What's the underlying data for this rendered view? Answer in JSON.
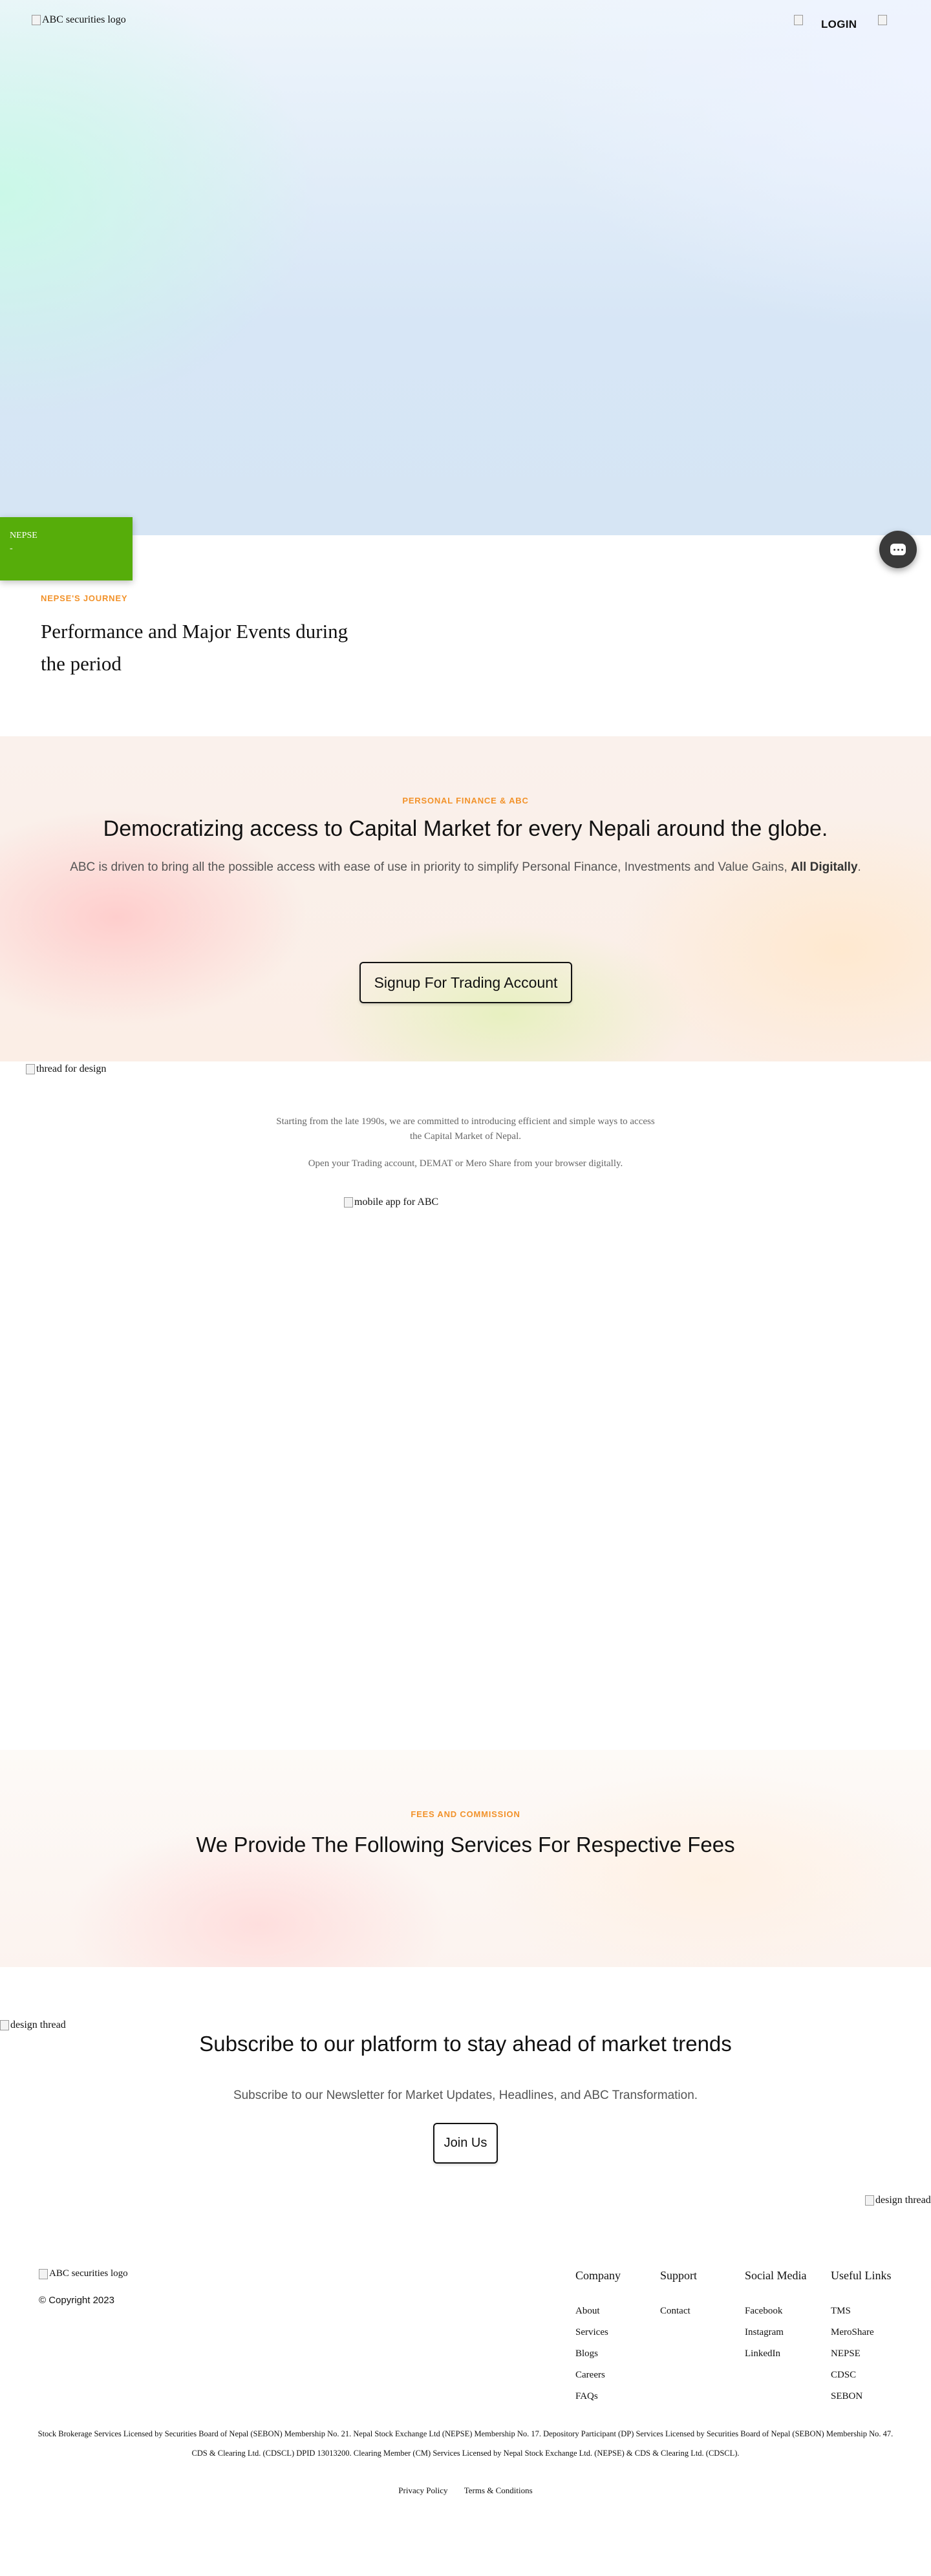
{
  "header": {
    "logo_alt": "ABC securities logo",
    "icon_alt": "",
    "login_label": "LOGIN",
    "lang_icon_alt": ""
  },
  "nepse_ticker": {
    "label": "NEPSE",
    "value": "-"
  },
  "journey": {
    "eyebrow": "NEPSE'S JOURNEY",
    "title": "Performance and Major Events during the period"
  },
  "personal_finance": {
    "eyebrow": "PERSONAL FINANCE & ABC",
    "title": "Democratizing access to Capital Market for every Nepali around the globe.",
    "description": "ABC is driven to bring all the possible access with ease of use in priority to simplify Personal Finance, Investments and Value Gains,",
    "description_emphasis": "All Digitally",
    "description_end": ".",
    "signup_label": "Signup For Trading Account"
  },
  "intro": {
    "thread_alt": "thread for design",
    "paragraph1": "Starting from the late 1990s, we are committed to introducing efficient and simple ways to access the Capital Market of Nepal.",
    "paragraph2": "Open your Trading account, DEMAT or Mero Share from your browser digitally.",
    "mobile_app_alt": "mobile app for ABC"
  },
  "fees": {
    "eyebrow": "FEES AND COMMISSION",
    "title": "We Provide The Following Services For Respective Fees"
  },
  "subscribe": {
    "thread_alt": "design thread",
    "title": "Subscribe to our platform to stay ahead of market trends",
    "description": "Subscribe to our Newsletter for Market Updates, Headlines, and ABC Transformation.",
    "join_label": "Join Us",
    "thread2_alt": "design thread"
  },
  "footer": {
    "logo_alt": "ABC securities logo",
    "copyright": "© Copyright 2023",
    "columns": [
      {
        "heading": "Company",
        "links": [
          "About",
          "Services",
          "Blogs",
          "Careers",
          "FAQs"
        ]
      },
      {
        "heading": "Support",
        "links": [
          "Contact"
        ]
      },
      {
        "heading": "Social Media",
        "links": [
          "Facebook",
          "Instagram",
          "LinkedIn"
        ]
      },
      {
        "heading": "Useful Links",
        "links": [
          "TMS",
          "MeroShare",
          "NEPSE",
          "CDSC",
          "SEBON"
        ]
      }
    ],
    "disclaimer": "Stock Brokerage Services Licensed by Securities Board of Nepal (SEBON) Membership No. 21. Nepal Stock Exchange Ltd (NEPSE) Membership No. 17. Depository Participant (DP) Services Licensed by Securities Board of Nepal (SEBON) Membership No. 47. CDS & Clearing Ltd. (CDSCL) DPID 13013200. Clearing Member (CM) Services Licensed by Nepal Stock Exchange Ltd. (NEPSE) & CDS & Clearing Ltd. (CDSCL).",
    "privacy_label": "Privacy Policy",
    "terms_label": "Terms & Conditions"
  }
}
